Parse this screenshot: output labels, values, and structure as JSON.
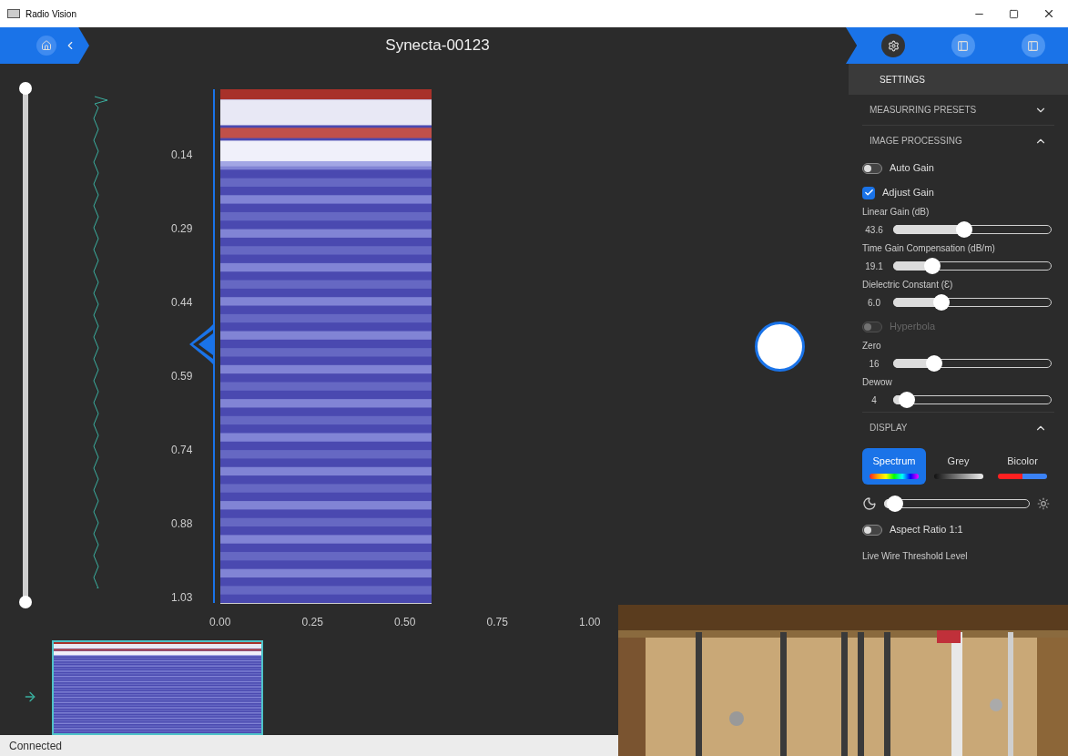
{
  "window": {
    "title": "Radio Vision"
  },
  "header": {
    "title": "Synecta-00123",
    "tabs": [
      {
        "kind": "settings",
        "selected": true
      },
      {
        "kind": "panel",
        "selected": false
      },
      {
        "kind": "panel",
        "selected": false
      }
    ]
  },
  "depth_slider": {
    "level": 1
  },
  "depth_axis": {
    "ticks": [
      "0.14",
      "0.29",
      "0.44",
      "0.59",
      "0.74",
      "0.88",
      "1.03"
    ]
  },
  "distance_axis": {
    "ticks": [
      "0.00",
      "0.25",
      "0.50",
      "0.75",
      "1.00"
    ]
  },
  "settings": {
    "title": "SETTINGS",
    "sections": [
      {
        "title": "MEASURRING PRESETS",
        "expanded": false
      },
      {
        "title": "IMAGE PROCESSING",
        "expanded": true,
        "controls": [
          {
            "kind": "toggle",
            "label": "Auto Gain",
            "on": false,
            "disabled": false
          },
          {
            "kind": "checkbox",
            "label": "Adjust Gain",
            "checked": true
          },
          {
            "kind": "slider",
            "label": "Linear Gain (dB)",
            "reading": "43.6",
            "level": 0.44
          },
          {
            "kind": "slider",
            "label": "Time Gain Compensation (dB/m)",
            "reading": "19.1",
            "level": 0.22
          },
          {
            "kind": "slider",
            "label": "Dielectric Constant (Ɛ)",
            "reading": "6.0",
            "level": 0.28
          },
          {
            "kind": "toggle",
            "label": "Hyperbola",
            "on": false,
            "disabled": true
          },
          {
            "kind": "slider",
            "label": "Zero",
            "reading": "16",
            "level": 0.23
          },
          {
            "kind": "slider",
            "label": "Dewow",
            "reading": "4",
            "level": 0.04
          }
        ]
      },
      {
        "title": "DISPLAY",
        "expanded": true,
        "controls": [
          {
            "kind": "modes",
            "options": [
              {
                "label": "Spectrum",
                "selected": true
              },
              {
                "label": "Grey",
                "selected": false
              },
              {
                "label": "Bicolor",
                "selected": false
              }
            ]
          },
          {
            "kind": "brightness",
            "level": 0.02
          },
          {
            "kind": "toggle",
            "label": "Aspect Ratio 1:1",
            "on": false,
            "disabled": false
          },
          {
            "kind": "label",
            "label": "Live Wire Threshold Level"
          }
        ]
      }
    ]
  },
  "status_bar": {
    "text": "Connected"
  }
}
